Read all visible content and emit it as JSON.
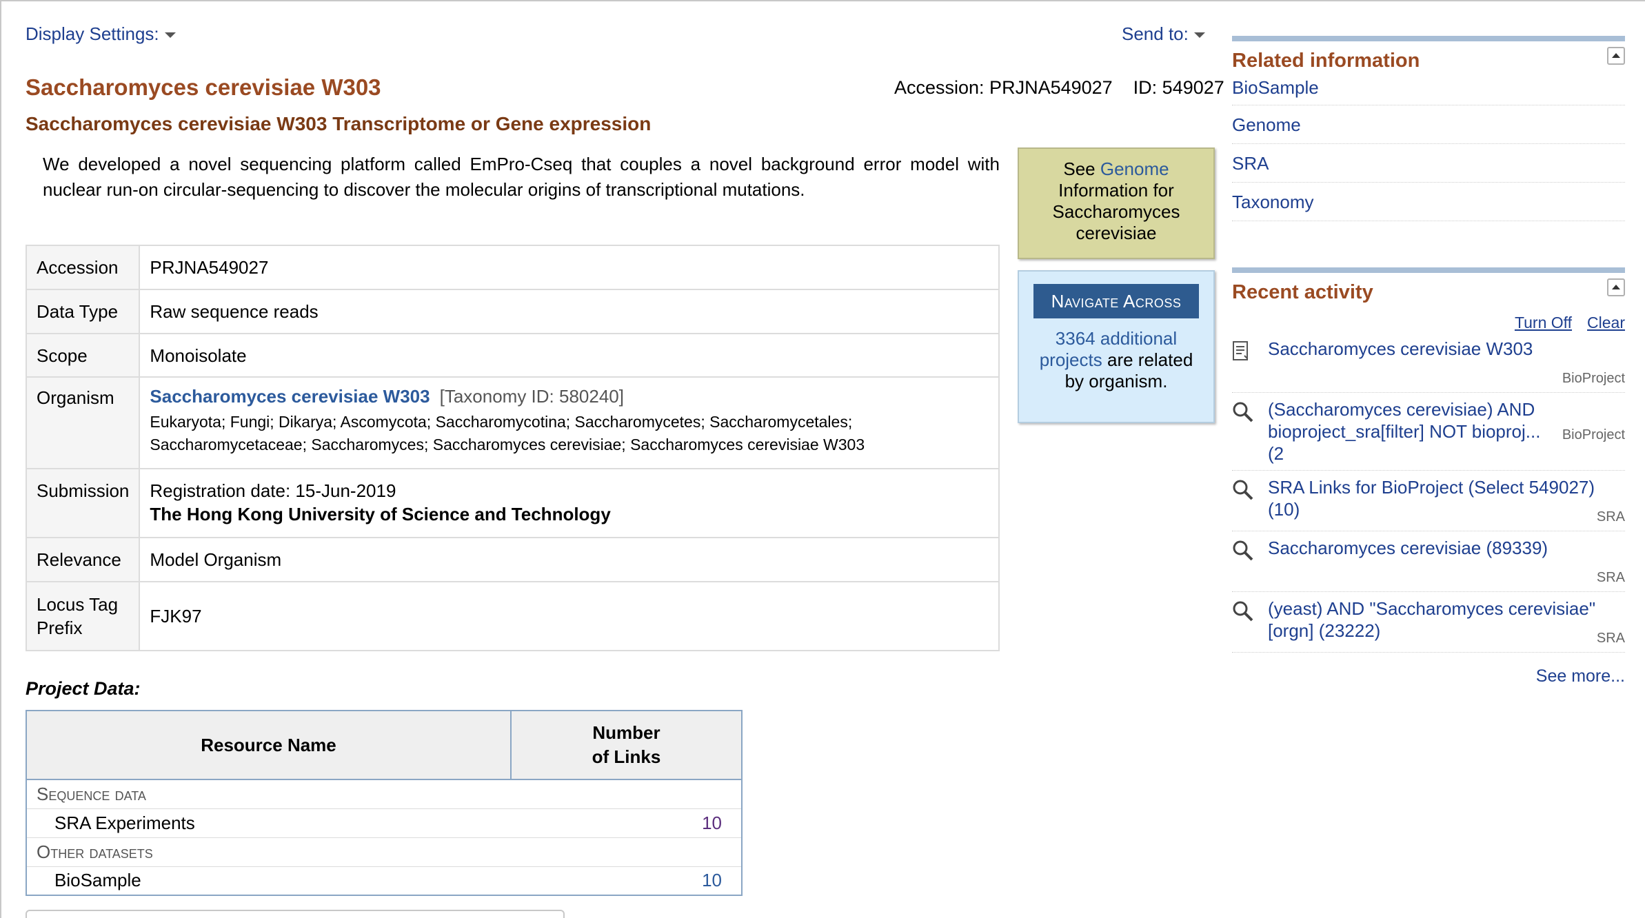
{
  "top": {
    "display_settings": "Display Settings:",
    "send_to": "Send to:"
  },
  "header": {
    "title": "Saccharomyces cerevisiae W303",
    "accession": "Accession: PRJNA549027",
    "id": "ID: 549027",
    "subtitle": "Saccharomyces cerevisiae W303 Transcriptome or Gene expression"
  },
  "description": "We developed a novel sequencing platform called EmPro-Cseq that couples a novel background error model with nuclear run-on circular-sequencing to discover the molecular origins of transcriptional mutations.",
  "details": {
    "accession_label": "Accession",
    "accession_value": "PRJNA549027",
    "datatype_label": "Data Type",
    "datatype_value": "Raw sequence reads",
    "scope_label": "Scope",
    "scope_value": "Monoisolate",
    "organism_label": "Organism",
    "organism_name": "Saccharomyces cerevisiae W303",
    "taxonomy_id": "[Taxonomy ID: 580240]",
    "lineage": "Eukaryota; Fungi; Dikarya; Ascomycota; Saccharomycotina; Saccharomycetes; Saccharomycetales; Saccharomycetaceae; Saccharomyces; Saccharomyces cerevisiae; Saccharomyces cerevisiae W303",
    "submission_label": "Submission",
    "registration": "Registration date: 15-Jun-2019",
    "institution": "The Hong Kong University of Science and Technology",
    "relevance_label": "Relevance",
    "relevance_value": "Model Organism",
    "locus_label_1": "Locus Tag",
    "locus_label_2": "Prefix",
    "locus_value": "FJK97"
  },
  "genome_box": {
    "see": "See",
    "link": "Genome",
    "rest": "Information for Saccharomyces cerevisiae"
  },
  "navigate": {
    "button": "Navigate Across",
    "count_link": "3364 additional projects",
    "rest": "are related by organism."
  },
  "project_data": {
    "heading": "Project Data:",
    "col_resource": "Resource Name",
    "col_links_1": "Number",
    "col_links_2": "of Links",
    "cat1": "Sequence data",
    "row1_name": "SRA Experiments",
    "row1_num": "10",
    "cat2": "Other datasets",
    "row2_name": "BioSample",
    "row2_num": "10"
  },
  "related": {
    "heading": "Related information",
    "items": [
      "BioSample",
      "Genome",
      "SRA",
      "Taxonomy"
    ]
  },
  "recent": {
    "heading": "Recent activity",
    "turn_off": "Turn Off",
    "clear": "Clear",
    "items": [
      {
        "text": "Saccharomyces cerevisiae W303",
        "db": "BioProject",
        "icon": "document-icon"
      },
      {
        "text": "(Saccharomyces cerevisiae) AND bioproject_sra[filter] NOT bioproj... (2",
        "db": "BioProject",
        "icon": "search-icon"
      },
      {
        "text": "SRA Links for BioProject (Select 549027) (10)",
        "db": "SRA",
        "icon": "search-icon"
      },
      {
        "text": "Saccharomyces cerevisiae (89339)",
        "db": "SRA",
        "icon": "search-icon"
      },
      {
        "text": "(yeast) AND \"Saccharomyces cerevisiae\" [orgn] (23222)",
        "db": "SRA",
        "icon": "search-icon"
      }
    ],
    "see_more": "See more..."
  }
}
